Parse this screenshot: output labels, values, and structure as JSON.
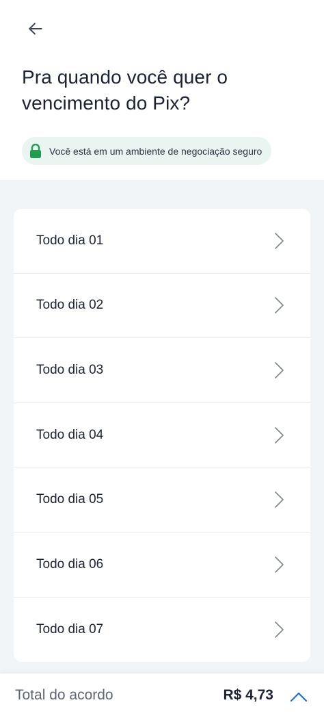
{
  "header": {
    "back_icon": "arrow-left-icon",
    "title": "Pra quando você quer o vencimento do Pix?"
  },
  "security_notice": {
    "icon": "lock-icon",
    "text": "Você está em um ambiente de negociação seguro",
    "icon_color": "#1e9c50"
  },
  "due_options": [
    {
      "label": "Todo dia 01"
    },
    {
      "label": "Todo dia 02"
    },
    {
      "label": "Todo dia 03"
    },
    {
      "label": "Todo dia 04"
    },
    {
      "label": "Todo dia 05"
    },
    {
      "label": "Todo dia 06"
    },
    {
      "label": "Todo dia 07"
    }
  ],
  "footer": {
    "label": "Total do acordo",
    "value": "R$ 4,73",
    "toggle_icon": "chevron-up-icon",
    "accent_color": "#1a73d9"
  }
}
